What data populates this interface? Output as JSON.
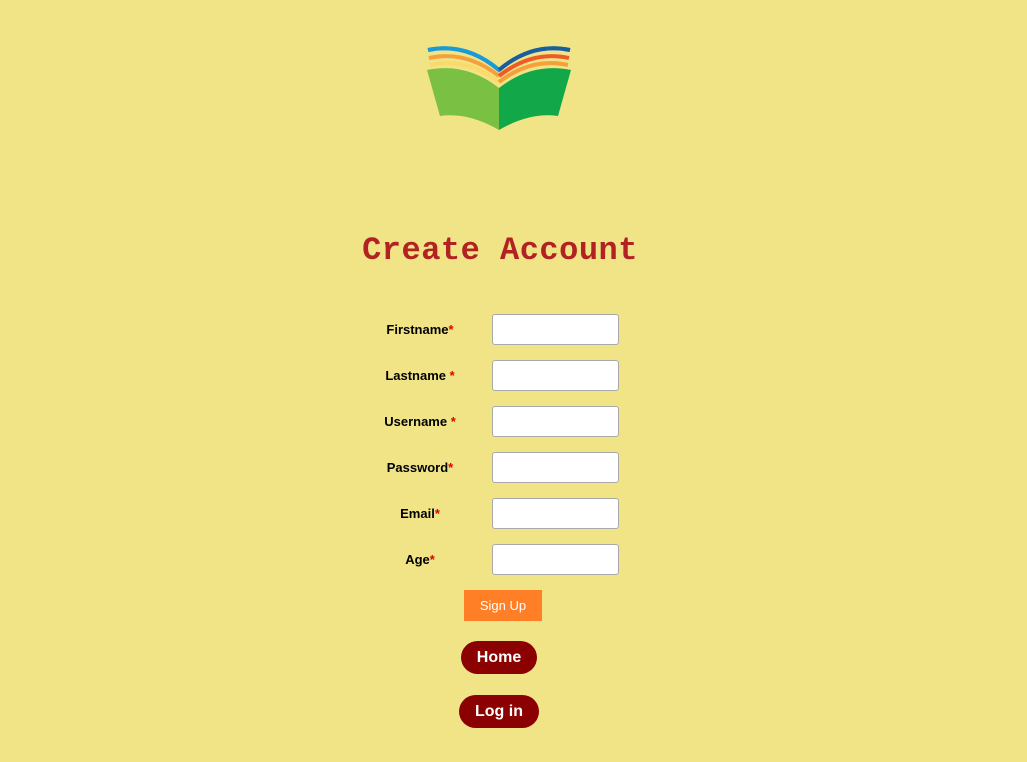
{
  "logo": {
    "icon": "open-book-logo-icon",
    "colors": [
      "#7AC143",
      "#12A84A",
      "#1A9BD7",
      "#F6A03B",
      "#F05A28",
      "#1B5E9E",
      "#FBD96A"
    ]
  },
  "page": {
    "title": "Create Account",
    "background": "#F0E486",
    "title_color": "#B22222"
  },
  "form": {
    "required_marker": "*",
    "fields": [
      {
        "label": "Firstname",
        "value": "",
        "placeholder": ""
      },
      {
        "label": "Lastname ",
        "value": "",
        "placeholder": ""
      },
      {
        "label": "Username ",
        "value": "",
        "placeholder": ""
      },
      {
        "label": "Password",
        "value": "",
        "placeholder": ""
      },
      {
        "label": "Email",
        "value": "",
        "placeholder": ""
      },
      {
        "label": "Age",
        "value": "",
        "placeholder": ""
      }
    ],
    "submit_label": "Sign Up",
    "submit_color": "#FF7F27"
  },
  "nav": {
    "home_label": "Home",
    "login_label": "Log in",
    "button_color": "#8B0000"
  }
}
